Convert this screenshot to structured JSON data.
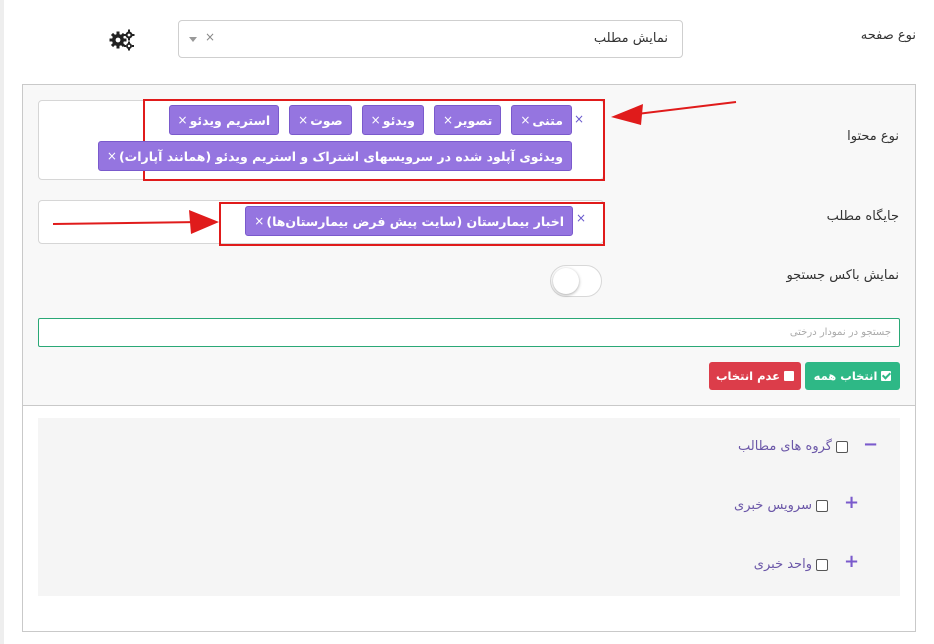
{
  "page_type": {
    "label": "نوع صفحه",
    "value": "نمایش مطلب",
    "clear": "×"
  },
  "content_type": {
    "label": "نوع محتوا",
    "clear": "×",
    "tags": [
      {
        "label": "متنی",
        "x": "×"
      },
      {
        "label": "تصویر",
        "x": "×"
      },
      {
        "label": "ویدئو",
        "x": "×"
      },
      {
        "label": "صوت",
        "x": "×"
      },
      {
        "label": "استریم ویدئو",
        "x": "×"
      },
      {
        "label": "ویدئوی آپلود شده در سرویسهای اشتراک و استریم ویدئو (همانند آپارات)",
        "x": "×"
      }
    ]
  },
  "placement": {
    "label": "جایگاه مطلب",
    "clear": "×",
    "tags": [
      {
        "label": "اخبار بیمارستان (سایت پیش فرض بیمارستان‌ها)",
        "x": "×"
      }
    ]
  },
  "search_box": {
    "label": "نمایش باکس جستجو",
    "enabled": false
  },
  "tree_search": {
    "placeholder": "جستجو در نمودار درختی"
  },
  "buttons": {
    "select_all": "انتخاب همه",
    "deselect": "عدم انتخاب"
  },
  "tree": {
    "root": {
      "label": "گروه های مطالب",
      "sign": "−"
    },
    "children": [
      {
        "label": "سرویس خبری",
        "sign": "+"
      },
      {
        "label": "واحد خبری",
        "sign": "+"
      }
    ]
  },
  "colors": {
    "tag_bg": "#9575e0",
    "highlight": "#e01b1b",
    "green": "#2eb886",
    "red": "#dc3d4a"
  }
}
